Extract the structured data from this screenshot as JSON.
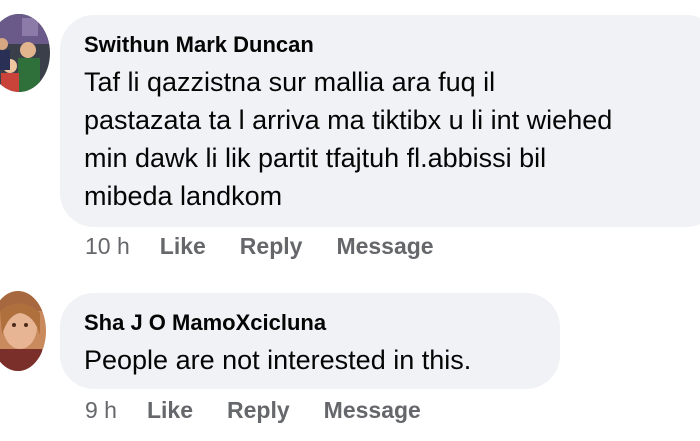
{
  "comments": [
    {
      "author": "Swithun Mark Duncan",
      "text": "Taf li qazzistna sur mallia ara fuq il\npastazata ta l arriva ma tiktibx u li int wiehed\nmin dawk li lik partit tfajtuh fl.abbissi bil\nmibeda landkom",
      "time": "10 h",
      "like_label": "Like",
      "reply_label": "Reply",
      "message_label": "Message",
      "avatar_icon": "profile-photo-group"
    },
    {
      "author": "Sha J O MamoXcicluna",
      "text": "People are not interested in this.",
      "time": "9 h",
      "like_label": "Like",
      "reply_label": "Reply",
      "message_label": "Message",
      "avatar_icon": "profile-photo-woman"
    }
  ],
  "colors": {
    "bubble_bg": "#f0f2f5",
    "text": "#050505",
    "meta": "#65676b"
  }
}
